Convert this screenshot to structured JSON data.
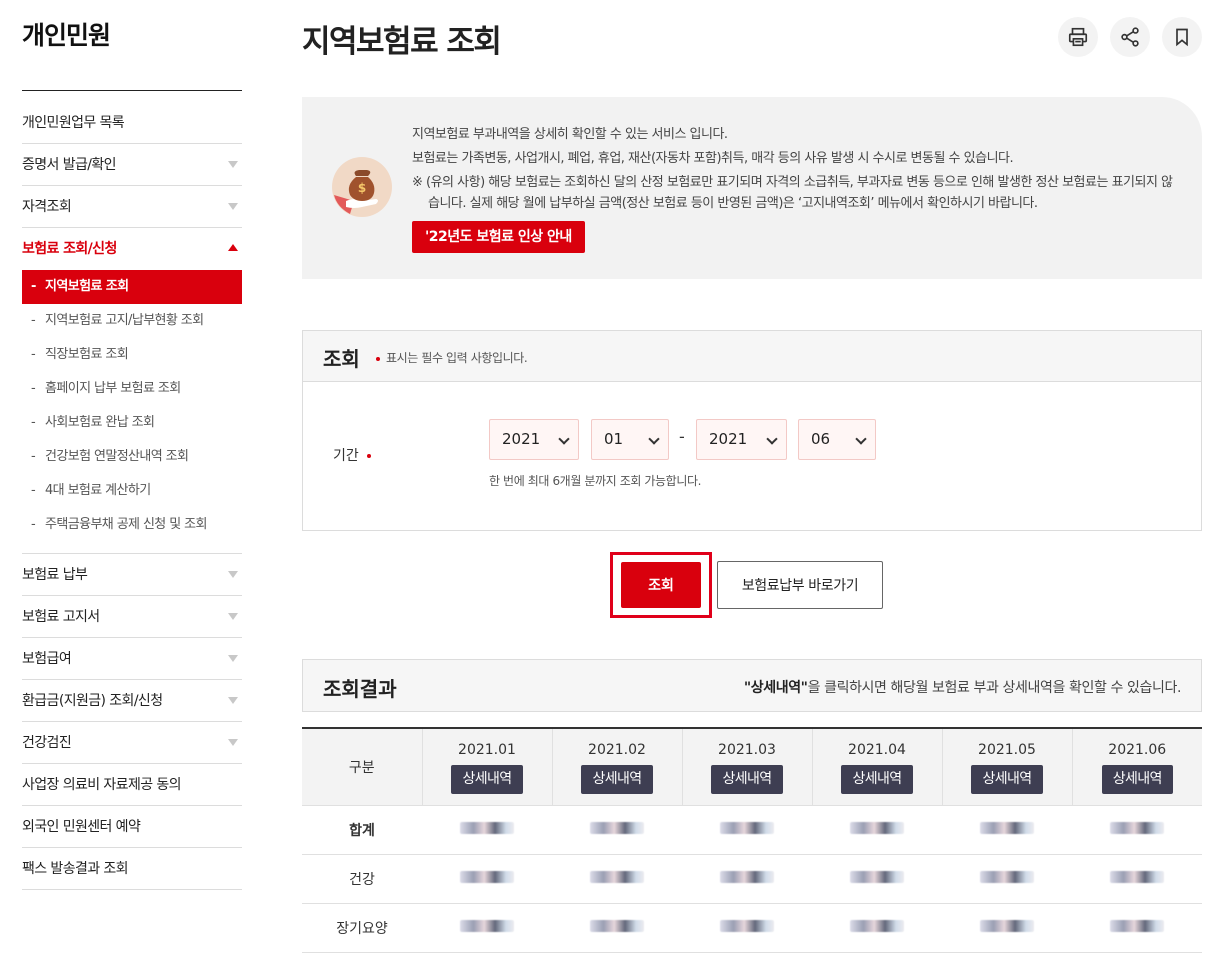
{
  "sidebar": {
    "title": "개인민원",
    "items": [
      {
        "label": "개인민원업무 목록",
        "arrow": false
      },
      {
        "label": "증명서 발급/확인",
        "arrow": true
      },
      {
        "label": "자격조회",
        "arrow": true
      },
      {
        "label": "보험료 조회/신청",
        "arrow": true,
        "active": true
      },
      {
        "label": "보험료 납부",
        "arrow": true
      },
      {
        "label": "보험료 고지서",
        "arrow": true
      },
      {
        "label": "보험급여",
        "arrow": true
      },
      {
        "label": "환급금(지원금) 조회/신청",
        "arrow": true
      },
      {
        "label": "건강검진",
        "arrow": true
      },
      {
        "label": "사업장 의료비 자료제공 동의",
        "arrow": false
      },
      {
        "label": "외국인 민원센터 예약",
        "arrow": false
      },
      {
        "label": "팩스 발송결과 조회",
        "arrow": false
      }
    ],
    "sub_items": [
      {
        "label": "지역보험료 조회"
      },
      {
        "label": "지역보험료 고지/납부현황 조회"
      },
      {
        "label": "직장보험료 조회"
      },
      {
        "label": "홈페이지 납부 보험료 조회"
      },
      {
        "label": "사회보험료 완납 조회"
      },
      {
        "label": "건강보험 연말정산내역 조회"
      },
      {
        "label": "4대 보험료 계산하기"
      },
      {
        "label": "주택금융부채 공제 신청 및 조회"
      }
    ],
    "dash": "-"
  },
  "header": {
    "title": "지역보험료 조회",
    "icons": [
      "print-icon",
      "share-icon",
      "bookmark-icon"
    ]
  },
  "info": {
    "line1": "지역보험료 부과내역을 상세히 확인할 수 있는 서비스 입니다.",
    "line2": "보험료는 가족변동, 사업개시, 폐업, 휴업, 재산(자동차 포함)취득, 매각 등의 사유 발생 시 수시로 변동될 수 있습니다.",
    "note": "※ (유의 사항) 해당 보험료는 조회하신 달의 산정 보험료만 표기되며 자격의 소급취득, 부과자료 변동 등으로 인해 발생한 정산 보험료는 표기되지 않습니다. 실제 해당 월에 납부하실 금액(정산 보험료 등이 반영된 금액)은 ‘고지내역조회’ 메뉴에서 확인하시기 바랍니다.",
    "notice_button": "'22년도 보험료 인상 안내"
  },
  "search": {
    "title": "조회",
    "required_note": "표시는 필수 입력 사항입니다.",
    "period_label": "기간",
    "start_year": "2021",
    "start_month": "01",
    "separator": "-",
    "end_year": "2021",
    "end_month": "06",
    "help": "한 번에 최대 6개월 분까지 조회 가능합니다.",
    "search_button": "조회",
    "pay_button": "보험료납부 바로가기"
  },
  "result": {
    "title": "조회결과",
    "hint_bold": "\"상세내역\"",
    "hint_rest": "을 클릭하시면 해당월 보험료 부과 상세내역을 확인할 수 있습니다.",
    "corner_label": "구분",
    "detail_label": "상세내역",
    "months": [
      "2021.01",
      "2021.02",
      "2021.03",
      "2021.04",
      "2021.05",
      "2021.06"
    ],
    "rows": [
      "합계",
      "건강",
      "장기요양"
    ]
  },
  "colors": {
    "accent": "#d9000d",
    "detail_button": "#3e3e52",
    "info_bg": "#f2f2f2"
  }
}
